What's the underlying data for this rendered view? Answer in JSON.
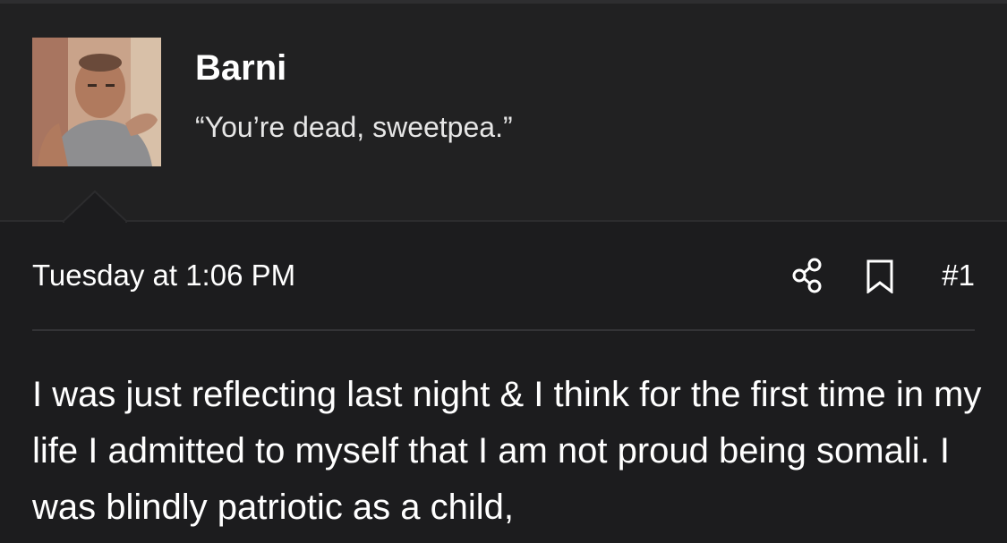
{
  "user": {
    "name": "Barni",
    "title": "“You’re dead, sweetpea.”"
  },
  "post": {
    "timestamp": "Tuesday at 1:06 PM",
    "number": "#1",
    "body": "I was just reflecting last night & I think for the first time in my life I admitted to myself that I am not proud being somali. I was blindly patriotic as a child,"
  },
  "icons": {
    "share": "share-icon",
    "bookmark": "bookmark-icon"
  },
  "colors": {
    "background": "#1c1c1e",
    "header_background": "#212122",
    "text": "#ffffff"
  }
}
